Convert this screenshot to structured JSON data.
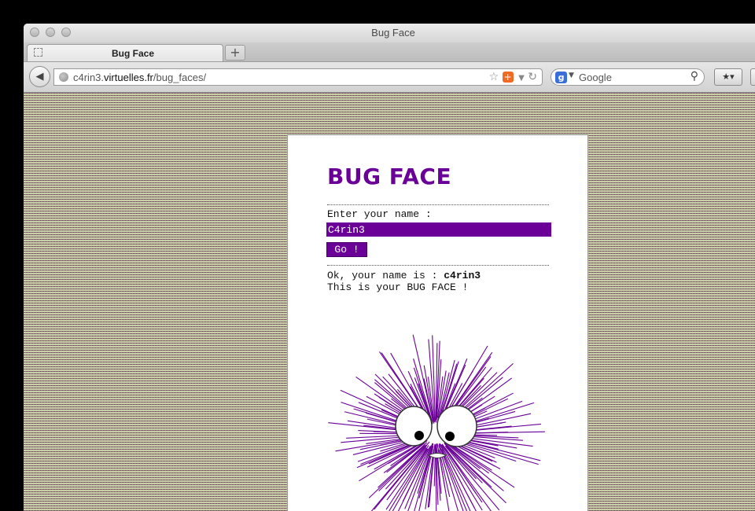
{
  "window": {
    "title": "Bug Face"
  },
  "tabs": [
    {
      "label": "Bug Face"
    }
  ],
  "new_tab": {
    "label": "+"
  },
  "address_bar": {
    "host_prefix": "c4rin3.",
    "host": "virtuelles.fr",
    "path": "/bug_faces/"
  },
  "search_bar": {
    "placeholder": "Google",
    "engine_badge": "g"
  },
  "page": {
    "heading": "BUG FACE",
    "name_label": "Enter your name :",
    "name_value": "C4rin3",
    "go_label": "Go !",
    "result_prefix": "Ok, your name is : ",
    "result_name": "c4rin3",
    "result_line2": "This is your BUG FACE !"
  },
  "colors": {
    "accent": "#6a0098",
    "stripe": "#9a2fa8",
    "stripe_alt": "#7d962d"
  },
  "icons": [
    "back-arrow-icon",
    "globe-icon",
    "star-icon",
    "addon-plus-icon",
    "reload-icon",
    "google-icon",
    "search-icon",
    "bookmarks-icon",
    "tab-favicon-icon"
  ]
}
